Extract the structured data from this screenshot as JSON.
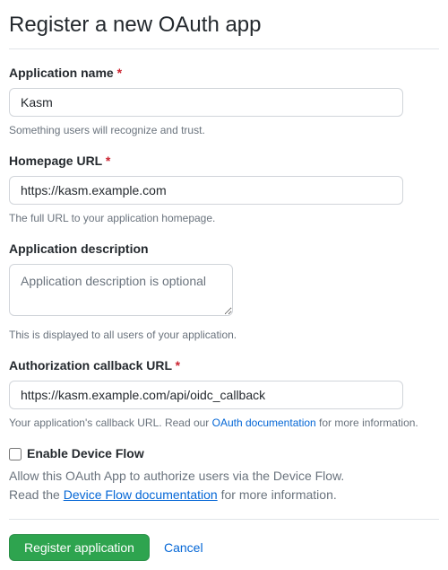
{
  "page": {
    "title": "Register a new OAuth app"
  },
  "required_indicator": "*",
  "fields": {
    "app_name": {
      "label": "Application name",
      "value": "Kasm",
      "note": "Something users will recognize and trust."
    },
    "homepage_url": {
      "label": "Homepage URL",
      "value": "https://kasm.example.com",
      "note": "The full URL to your application homepage."
    },
    "app_description": {
      "label": "Application description",
      "placeholder": "Application description is optional",
      "value": "",
      "note": "This is displayed to all users of your application."
    },
    "callback_url": {
      "label": "Authorization callback URL",
      "value": "https://kasm.example.com/api/oidc_callback",
      "note_prefix": "Your application's callback URL. Read our ",
      "note_link": "OAuth documentation",
      "note_suffix": " for more information."
    },
    "device_flow": {
      "label": "Enable Device Flow",
      "note_line1": "Allow this OAuth App to authorize users via the Device Flow.",
      "note_line2_prefix": "Read the ",
      "note_line2_link": "Device Flow documentation",
      "note_line2_suffix": " for more information."
    }
  },
  "actions": {
    "submit": "Register application",
    "cancel": "Cancel"
  }
}
